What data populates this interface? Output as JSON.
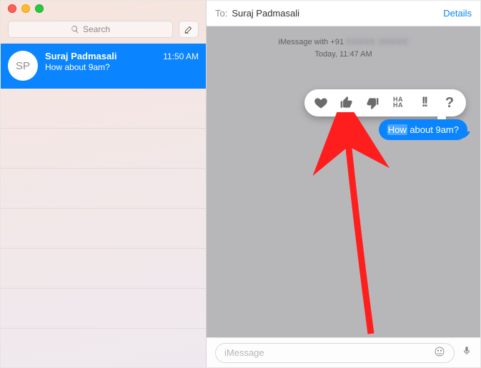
{
  "sidebar": {
    "search_placeholder": "Search",
    "conversations": [
      {
        "initials": "SP",
        "name": "Suraj Padmasali",
        "time": "11:50 AM",
        "preview": "How about 9am?"
      }
    ]
  },
  "header": {
    "to_label": "To:",
    "to_name": "Suraj Padmasali",
    "details_label": "Details"
  },
  "thread": {
    "meta_line1_prefix": "iMessage with +91 ",
    "meta_line1_redacted": "XXXXX XXXXX",
    "meta_line2": "Today, 11:47 AM",
    "message_highlight": "How",
    "message_rest": " about 9am?"
  },
  "tapback": {
    "haha": "HA\nHA",
    "bang": "!!",
    "question": "?"
  },
  "input": {
    "placeholder": "iMessage"
  }
}
